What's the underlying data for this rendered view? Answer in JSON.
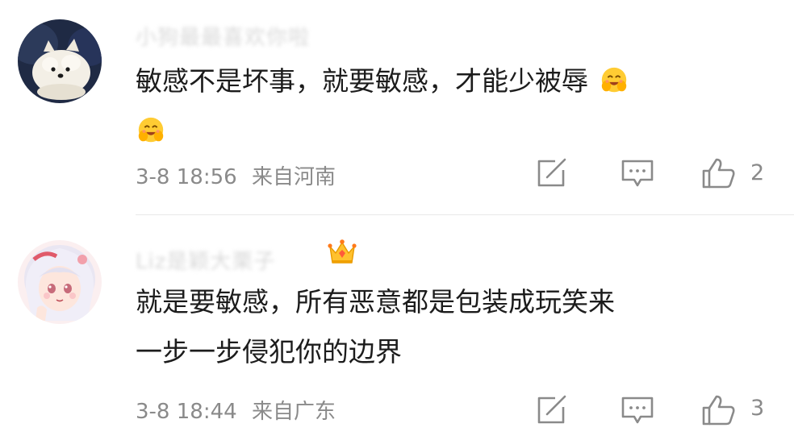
{
  "comments": [
    {
      "username": "小狗最最喜欢你啦",
      "text_line1": "敏感不是坏事，就要敏感，才能少被辱",
      "emoji_name": "smiling-face-with-hands-emoji",
      "date": "3-8 18:56",
      "location": "来自河南",
      "likes": "2"
    },
    {
      "username": "Liz是颖大栗子",
      "badge_icon": "crown-icon",
      "text_line1": "就是要敏感，所有恶意都是包装成玩笑来",
      "text_line2": "一步一步侵犯你的边界",
      "date": "3-8 18:44",
      "location": "来自广东",
      "likes": "3"
    }
  ],
  "icons": {
    "share": "share-edit-icon",
    "comment": "comment-icon",
    "like": "thumbs-up-icon"
  },
  "colors": {
    "text": "#1c1c1c",
    "meta": "#8a8a8a",
    "icon": "#8a8a8a",
    "divider": "#e8e8e8"
  }
}
